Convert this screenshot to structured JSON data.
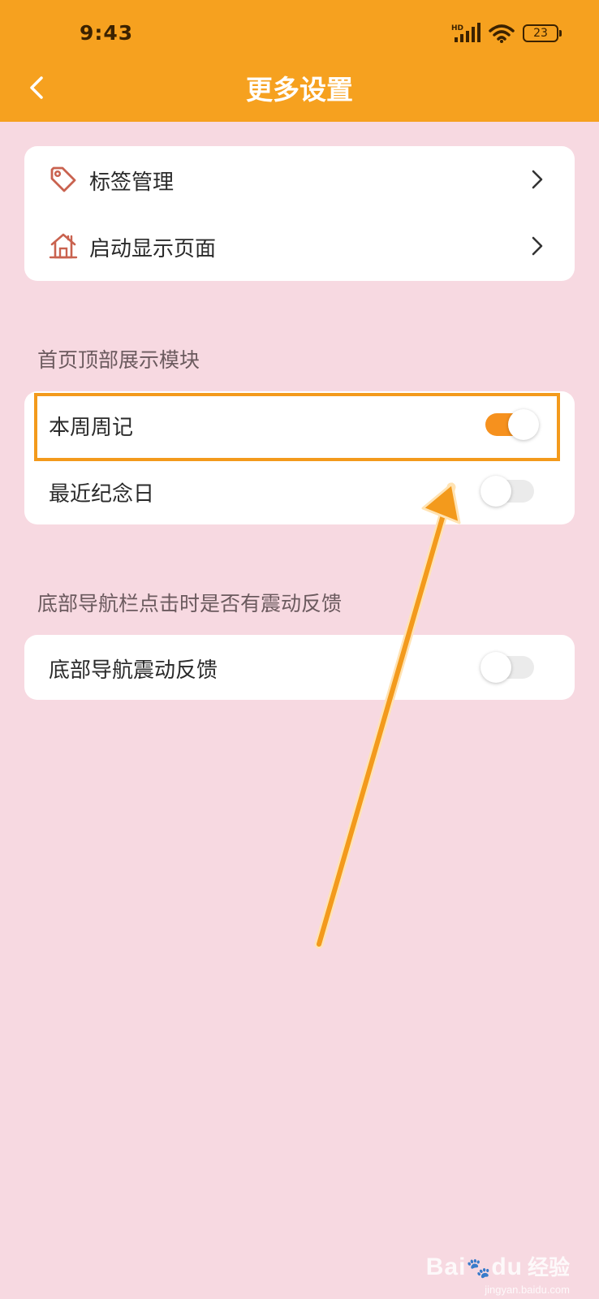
{
  "status_bar": {
    "time": "9:43",
    "network_label": "HD",
    "battery_level": "23"
  },
  "header": {
    "title": "更多设置",
    "background_color": "#f6a11f"
  },
  "nav_card": {
    "items": [
      {
        "label": "标签管理",
        "icon": "tag-icon"
      },
      {
        "label": "启动显示页面",
        "icon": "house-icon"
      }
    ]
  },
  "top_section": {
    "title": "首页顶部展示模块",
    "items": [
      {
        "label": "本周周记",
        "enabled": true
      },
      {
        "label": "最近纪念日",
        "enabled": false
      }
    ]
  },
  "bottom_section": {
    "title": "底部导航栏点击时是否有震动反馈",
    "items": [
      {
        "label": "底部导航震动反馈",
        "enabled": false
      }
    ]
  },
  "accent_color": "#f6911e",
  "watermark": {
    "brand": "Bai",
    "brand_suffix": "du",
    "cn": "经验",
    "domain": "jingyan.baidu.com"
  }
}
